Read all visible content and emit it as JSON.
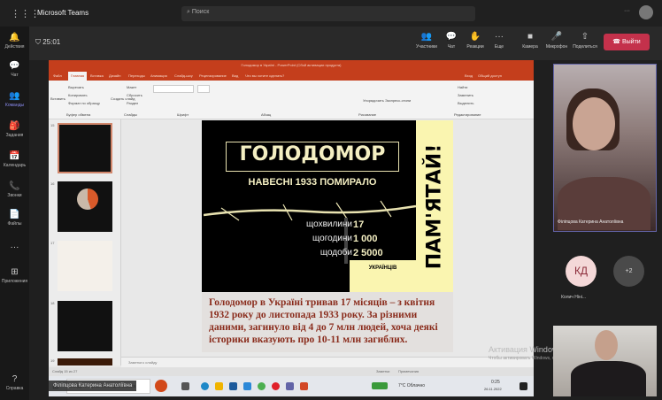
{
  "app": {
    "title": "Microsoft Teams",
    "search_placeholder": "Поиск",
    "grid_icon": "⋮⋮⋮",
    "more": "···"
  },
  "rail": [
    {
      "label": "Действия",
      "icon": "🔔"
    },
    {
      "label": "Чат",
      "icon": "💬"
    },
    {
      "label": "Команды",
      "icon": "👥"
    },
    {
      "label": "Задания",
      "icon": "🎒"
    },
    {
      "label": "Календарь",
      "icon": "📅"
    },
    {
      "label": "Звонки",
      "icon": "📞"
    },
    {
      "label": "Файлы",
      "icon": "📄"
    },
    {
      "label": "",
      "icon": "···"
    },
    {
      "label": "Приложения",
      "icon": "⊞"
    },
    {
      "label": "Справка",
      "icon": "?"
    }
  ],
  "meeting": {
    "timer": "25:01",
    "buttons": [
      {
        "label": "Участники",
        "icon": "👥"
      },
      {
        "label": "Чат",
        "icon": "💬"
      },
      {
        "label": "Реакции",
        "icon": "✋"
      },
      {
        "label": "Еще",
        "icon": "···"
      },
      {
        "label": "Камера",
        "icon": "■"
      },
      {
        "label": "Микрофон",
        "icon": "🎤"
      },
      {
        "label": "Поделиться",
        "icon": "⇧"
      }
    ],
    "leave": "Выйти"
  },
  "ppt": {
    "title": "Голодомор в Україні - PowerPoint (Сбой активации продукта)",
    "tabs": [
      "Файл",
      "Главная",
      "Вставка",
      "Дизайн",
      "Переходы",
      "Анимация",
      "Слайд-шоу",
      "Рецензирование",
      "Вид",
      "Что вы хотите сделать?"
    ],
    "share_label": "Общий доступ",
    "signin": "Вход",
    "ribbon": {
      "paste": "Вставить",
      "cut": "Вырезать",
      "copy": "Копировать",
      "format": "Формат по образцу",
      "clipboard": "Буфер обмена",
      "new_slide": "Создать слайд",
      "layout": "Макет",
      "reset": "Сбросить",
      "section": "Раздел",
      "slides": "Слайды",
      "font": "Шрифт",
      "paragraph": "Абзац",
      "drawing": "Рисование",
      "arrange": "Упорядочить",
      "quick_styles": "Экспресс-стили",
      "find": "Найти",
      "replace": "Заменить",
      "select": "Выделить",
      "editing": "Редактирование"
    },
    "thumb_numbers": [
      "15",
      "16",
      "17",
      "18",
      "19"
    ],
    "notes_placeholder": "Заметки к слайду",
    "status": "Слайд 15 из 27",
    "notes_btn": "Заметки",
    "comments_btn": "Примечания"
  },
  "slide": {
    "title": "ГОЛОДОМОР",
    "subtitle": "НАВЕСНІ 1933 ПОМИРАЛО",
    "side": "ПАМ'ЯТАЙ!",
    "stats": [
      {
        "label": "щохвилини",
        "value": "17"
      },
      {
        "label": "щогодини",
        "value": "1 000"
      },
      {
        "label": "щодоби",
        "value": "2 5000"
      }
    ],
    "unit": "УКРАЇНЦІВ",
    "description": "Голодомор в Україні тривав 17 місяців – з квітня 1932 року до листопада 1933 року. За різними даними, загинуло від 4 до 7 млн людей, хоча деякі історики вказують про 10-11 млн загиблих."
  },
  "taskbar": {
    "search": "Введите здесь текст для поиска",
    "weather": "7°C Облачно",
    "time": "0:25",
    "date": "26.11.2022"
  },
  "activation": {
    "title": "Активация Windows",
    "sub": "Чтобы активировать Windows, перейдите в раздел"
  },
  "participants": {
    "presenter": "Філіпцова Катерина Анатоліївна",
    "kd_initials": "КД",
    "kd_name": "Колич Ніні...",
    "more": "+2"
  }
}
